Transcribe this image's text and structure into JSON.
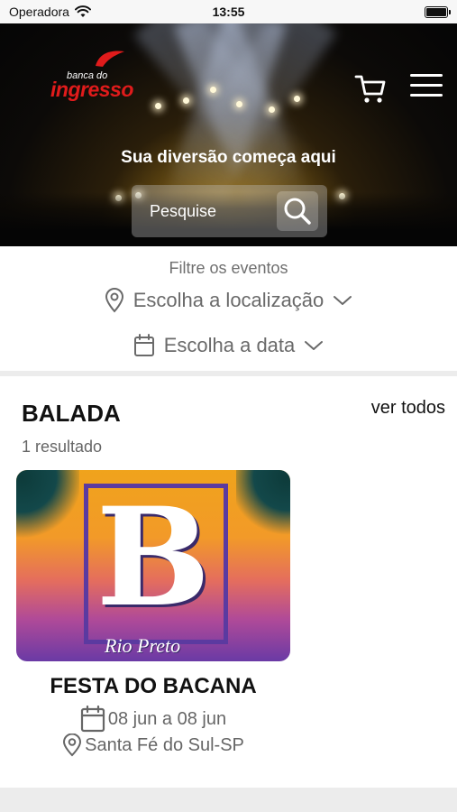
{
  "status_bar": {
    "carrier": "Operadora",
    "time": "13:55"
  },
  "header": {
    "logo_small": "banca do",
    "logo_main": "ingresso",
    "logo_color": "#e01b1b",
    "cart_icon": "cart-icon",
    "menu_icon": "hamburger-menu-icon"
  },
  "hero": {
    "title": "Sua diversão começa aqui"
  },
  "search": {
    "placeholder": "Pesquise",
    "icon": "search-icon"
  },
  "filters": {
    "label": "Filtre os eventos",
    "location": "Escolha a localização",
    "date": "Escolha a data"
  },
  "section": {
    "title": "BALADA",
    "see_all": "ver todos",
    "results": "1 resultado"
  },
  "events": [
    {
      "image_letter": "B",
      "image_script": "Rio Preto",
      "name": "FESTA DO BACANA",
      "date": "08 jun a 08 jun",
      "location": "Santa Fé do Sul-SP"
    }
  ]
}
